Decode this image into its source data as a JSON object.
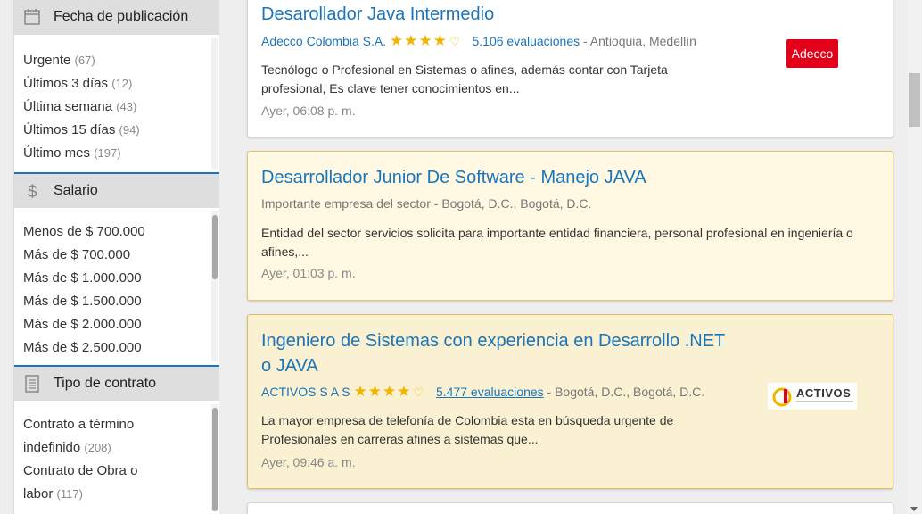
{
  "sidebar": {
    "date_filter": {
      "title": "Fecha de publicación",
      "items": [
        {
          "label": "Urgente",
          "count": "(67)"
        },
        {
          "label": "Últimos 3 días",
          "count": "(12)"
        },
        {
          "label": "Última semana",
          "count": "(43)"
        },
        {
          "label": "Últimos 15 días",
          "count": "(94)"
        },
        {
          "label": "Último mes",
          "count": "(197)"
        }
      ]
    },
    "salary_filter": {
      "title": "Salario",
      "items": [
        {
          "label": "Menos de $ 700.000"
        },
        {
          "label": "Más de $ 700.000"
        },
        {
          "label": "Más de $ 1.000.000"
        },
        {
          "label": "Más de $ 1.500.000"
        },
        {
          "label": "Más de $ 2.000.000"
        },
        {
          "label": "Más de $ 2.500.000"
        }
      ]
    },
    "contract_filter": {
      "title": "Tipo de contrato",
      "items": [
        {
          "label_line1": "Contrato a término",
          "label_line2": "indefinido",
          "count": "(208)"
        },
        {
          "label_line1": "Contrato de Obra o",
          "label_line2": "labor",
          "count": "(117)"
        }
      ]
    }
  },
  "jobs": [
    {
      "title": "Desarollador Java Intermedio",
      "company": "Adecco Colombia S.A.",
      "stars": "★★★★",
      "heart": "♡",
      "reviews": "5.106 evaluaciones",
      "location": "- Antioquia, Medellín",
      "description": "Tecnólogo o Profesional en Sistemas o afines, además contar con Tarjeta profesional, Es clave tener conocimientos en...",
      "posted": "Ayer, 06:08 p. m.",
      "logo_text": "Adecco"
    },
    {
      "title": "Desarrollador Junior De Software - Manejo JAVA",
      "company": "Importante empresa del sector",
      "location": "- Bogotá, D.C., Bogotá, D.C.",
      "description": "Entidad del sector servicios solicita para importante entidad financiera, personal profesional en ingeniería o afines,...",
      "posted": "Ayer, 01:03 p. m."
    },
    {
      "title_line1": "Ingeniero de Sistemas con experiencia en Desarrollo .NET",
      "title_line2": "o JAVA",
      "company": "ACTIVOS S A S",
      "stars": "★★★★",
      "heart": "♡",
      "reviews": "5.477 evaluaciones",
      "location": "- Bogotá, D.C., Bogotá, D.C.",
      "description": "La mayor empresa de telefonía de Colombia esta en búsqueda urgente de Profesionales en carreras afines a sistemas que...",
      "posted": "Ayer, 09:46 a. m.",
      "logo_text": "ACTIVOS"
    }
  ],
  "colors": {
    "accent": "#1b75bb",
    "star": "#f2b400",
    "featured_bg": "#fff8e2"
  }
}
